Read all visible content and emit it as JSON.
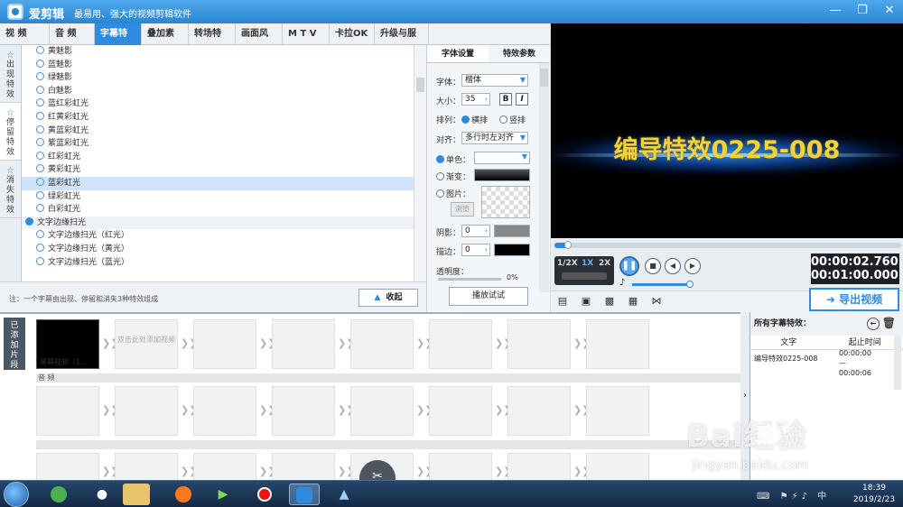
{
  "app": {
    "name": "爱剪辑",
    "slogan": "最易用、强大的视频剪辑软件"
  },
  "menu": [
    {
      "label": "视 频",
      "active": false
    },
    {
      "label": "音 频",
      "active": false
    },
    {
      "label": "字幕特效",
      "active": true
    },
    {
      "label": "叠加素材",
      "active": false
    },
    {
      "label": "转场特效",
      "active": false
    },
    {
      "label": "画面风格",
      "active": false
    },
    {
      "label": "M T V",
      "active": false
    },
    {
      "label": "卡拉OK",
      "active": false
    },
    {
      "label": "升级与服务",
      "active": false
    }
  ],
  "vtabs": [
    {
      "label": "出现特效",
      "active": false
    },
    {
      "label": "停留特效",
      "active": true
    },
    {
      "label": "消失特效",
      "active": false
    }
  ],
  "effects": [
    {
      "label": "黄魅影"
    },
    {
      "label": "蓝魅影"
    },
    {
      "label": "绿魅影"
    },
    {
      "label": "白魅影"
    },
    {
      "label": "蓝红彩虹光"
    },
    {
      "label": "红黄彩虹光"
    },
    {
      "label": "黄蓝彩虹光"
    },
    {
      "label": "紫蓝彩虹光"
    },
    {
      "label": "红彩虹光"
    },
    {
      "label": "黄彩虹光"
    },
    {
      "label": "蓝彩虹光",
      "selected": true
    },
    {
      "label": "绿彩虹光"
    },
    {
      "label": "白彩虹光"
    },
    {
      "label": "文字边缘扫光",
      "group": true
    },
    {
      "label": "文字边缘扫光（红光）"
    },
    {
      "label": "文字边缘扫光（黄光）"
    },
    {
      "label": "文字边缘扫光（蓝光）"
    }
  ],
  "note": "注：一个字幕由出现、停留和消失3种特效组成",
  "collapse_label": "收起",
  "props": {
    "tab_font": "字体设置",
    "tab_effect": "特效参数",
    "font_label": "字体：",
    "font_value": "楷体",
    "size_label": "大小：",
    "size_value": "35",
    "bold": "B",
    "italic": "I",
    "arrange_label": "排列：",
    "arrange_h": "横排",
    "arrange_v": "竖排",
    "align_label": "对齐：",
    "align_value": "多行时左对齐",
    "mono_label": "单色：",
    "grad_label": "渐变：",
    "image_label": "图片：",
    "browse_label": "浏览",
    "shadow_label": "阴影：",
    "shadow_value": "0",
    "stroke_label": "描边：",
    "stroke_value": "0",
    "opacity_label": "透明度：",
    "opacity_value": "0%",
    "play_test": "播放试试"
  },
  "preview": {
    "subtitle": "编导特效0225-008"
  },
  "player": {
    "speed_half": "1/2X",
    "speed_1x": "1X",
    "speed_2x": "2X",
    "progress": 0.04,
    "current_time": "00:00:02.760",
    "total_time": "00:01:00.000",
    "volume": 0.6
  },
  "export_label": "导出视频",
  "timeline": {
    "added_label": "已添加片段",
    "first_clip_caption": "黑幕视频（1...",
    "add_hint": "双击此处添加视频",
    "audio_label": "音 频"
  },
  "subtitles_panel": {
    "title": "所有字幕特效：",
    "col_text": "文字",
    "col_time": "起止时间",
    "rows": [
      {
        "text": "编导特效0225-008",
        "start": "00:00:00",
        "end": "00:00:06"
      }
    ]
  },
  "taskbar": {
    "time": "18:39",
    "date": "2019/2/23"
  },
  "watermark": {
    "brand": "Bai经验",
    "url": "jingyan.baidu.com"
  }
}
